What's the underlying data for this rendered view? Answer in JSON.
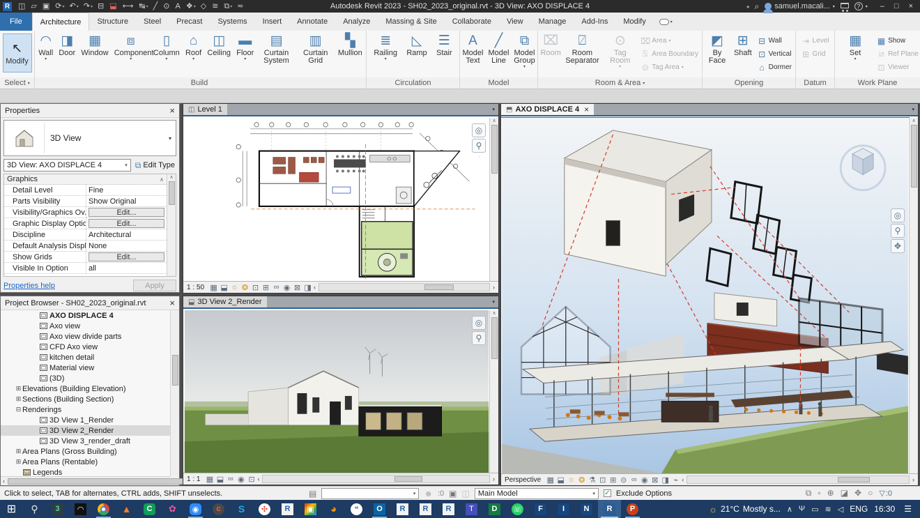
{
  "titlebar": {
    "title": "Autodesk Revit 2023 - SH02_2023_original.rvt - 3D View: AXO DISPLACE 4",
    "logo": "R",
    "quick_access": [
      {
        "name": "file-properties-icon",
        "glyph": "◫"
      },
      {
        "name": "open-file-icon",
        "glyph": "▱"
      },
      {
        "name": "save-icon",
        "glyph": "▣"
      },
      {
        "name": "sync-with-central-icon",
        "glyph": "⟳",
        "arrow": "▾"
      },
      {
        "name": "undo-icon",
        "glyph": "↶",
        "arrow": "▾"
      },
      {
        "name": "redo-icon",
        "glyph": "↷",
        "arrow": "▾"
      },
      {
        "name": "print-icon",
        "glyph": "⊟"
      },
      {
        "name": "export-pdf-icon",
        "glyph": "⬓"
      },
      {
        "name": "measure-icon",
        "glyph": "⟷"
      },
      {
        "name": "aligned-dimension-icon",
        "glyph": "↹",
        "arrow": "▾"
      },
      {
        "name": "detail-line-icon",
        "glyph": "╱"
      },
      {
        "name": "tag-by-category-icon",
        "glyph": "⊙"
      },
      {
        "name": "text-note-icon",
        "glyph": "A"
      },
      {
        "name": "default-3d-view-icon",
        "glyph": "❖",
        "arrow": "▾"
      },
      {
        "name": "section-icon",
        "glyph": "◇"
      },
      {
        "name": "thin-lines-icon",
        "glyph": "≋"
      },
      {
        "name": "switch-windows-icon",
        "glyph": "⧉",
        "arrow": "▾"
      },
      {
        "name": "customize-quick-access-icon",
        "glyph": "≂"
      }
    ],
    "collapse_arrow": "◂",
    "search_glyph": "⌕",
    "user": "samuel.macali...",
    "user_arrow": "▾",
    "help_glyph": "?",
    "help_arrow": "▾",
    "minimize": "–",
    "restore": "□",
    "close": "×"
  },
  "ribbon": {
    "tabs": [
      {
        "label": "File",
        "state": "file"
      },
      {
        "label": "Architecture",
        "state": "active"
      },
      {
        "label": "Structure"
      },
      {
        "label": "Steel"
      },
      {
        "label": "Precast"
      },
      {
        "label": "Systems"
      },
      {
        "label": "Insert"
      },
      {
        "label": "Annotate"
      },
      {
        "label": "Analyze"
      },
      {
        "label": "Massing & Site"
      },
      {
        "label": "Collaborate"
      },
      {
        "label": "View"
      },
      {
        "label": "Manage"
      },
      {
        "label": "Add-Ins"
      },
      {
        "label": "Modify"
      }
    ],
    "modify_options_arrow": "▾",
    "select": {
      "caption": "Select",
      "caption_arrow": "▾",
      "modify_label": "Modify",
      "modify_icon_glyph": "↖"
    },
    "build": {
      "caption": "Build",
      "buttons": [
        {
          "label": "Wall",
          "icon": "wall-icon",
          "glyph": "◠",
          "arrow": "▾"
        },
        {
          "label": "Door",
          "icon": "door-icon",
          "glyph": "◨"
        },
        {
          "label": "Window",
          "icon": "window-icon",
          "glyph": "▦"
        },
        {
          "label": "Component",
          "icon": "component-icon",
          "glyph": "⧈",
          "arrow": "▾"
        },
        {
          "label": "Column",
          "icon": "column-icon",
          "glyph": "▯",
          "arrow": "▾"
        },
        {
          "label": "Roof",
          "icon": "roof-icon",
          "glyph": "⌂",
          "arrow": "▾"
        },
        {
          "label": "Ceiling",
          "icon": "ceiling-icon",
          "glyph": "◫"
        },
        {
          "label": "Floor",
          "icon": "floor-icon",
          "glyph": "▬",
          "arrow": "▾"
        },
        {
          "label": "Curtain System",
          "icon": "curtain-system-icon",
          "glyph": "▤"
        },
        {
          "label": "Curtain Grid",
          "icon": "curtain-grid-icon",
          "glyph": "▥"
        },
        {
          "label": "Mullion",
          "icon": "mullion-icon",
          "glyph": "▚"
        }
      ]
    },
    "circulation": {
      "caption": "Circulation",
      "buttons": [
        {
          "label": "Railing",
          "icon": "railing-icon",
          "glyph": "≣",
          "arrow": "▾"
        },
        {
          "label": "Ramp",
          "icon": "ramp-icon",
          "glyph": "◺"
        },
        {
          "label": "Stair",
          "icon": "stair-icon",
          "glyph": "☰"
        }
      ]
    },
    "model": {
      "caption": "Model",
      "buttons": [
        {
          "label": "Model Text",
          "icon": "model-text-icon",
          "glyph": "A"
        },
        {
          "label": "Model Line",
          "icon": "model-line-icon",
          "glyph": "╱"
        },
        {
          "label": "Model Group",
          "icon": "model-group-icon",
          "glyph": "⧉",
          "arrow": "▾"
        }
      ]
    },
    "room": {
      "caption": "Room & Area",
      "caption_arrow": "▾",
      "large": [
        {
          "label": "Room",
          "icon": "room-icon",
          "glyph": "⌧",
          "state": "disabled"
        },
        {
          "label": "Room Separator",
          "icon": "room-separator-icon",
          "glyph": "⍁"
        },
        {
          "label": "Tag Room",
          "icon": "tag-room-icon",
          "glyph": "⊙",
          "arrow": "▾",
          "state": "disabled"
        }
      ],
      "small": [
        {
          "label": "Area",
          "icon": "area-icon",
          "glyph": "⌧",
          "arrow": "▾",
          "state": "disabled"
        },
        {
          "label": "Area Boundary",
          "icon": "area-boundary-icon",
          "glyph": "⍂",
          "state": "disabled"
        },
        {
          "label": "Tag Area",
          "icon": "tag-area-icon",
          "glyph": "⊙",
          "arrow": "▾",
          "state": "disabled"
        }
      ]
    },
    "opening": {
      "caption": "Opening",
      "large": [
        {
          "label": "By Face",
          "icon": "opening-by-face-icon",
          "glyph": "◩"
        },
        {
          "label": "Shaft",
          "icon": "shaft-opening-icon",
          "glyph": "⊞"
        }
      ],
      "small": [
        {
          "label": "Wall",
          "icon": "wall-opening-icon",
          "glyph": "⊟"
        },
        {
          "label": "Vertical",
          "icon": "vertical-opening-icon",
          "glyph": "⊡"
        },
        {
          "label": "Dormer",
          "icon": "dormer-opening-icon",
          "glyph": "⌂"
        }
      ]
    },
    "datum": {
      "caption": "Datum",
      "small": [
        {
          "label": "Level",
          "icon": "level-icon",
          "glyph": "⇥",
          "state": "disabled"
        },
        {
          "label": "Grid",
          "icon": "grid-icon",
          "glyph": "⊞",
          "state": "disabled"
        }
      ]
    },
    "workplane": {
      "caption": "Work Plane",
      "large": [
        {
          "label": "Set",
          "icon": "set-work-plane-icon",
          "glyph": "▦",
          "arrow": "▾"
        }
      ],
      "small": [
        {
          "label": "Show",
          "icon": "show-work-plane-icon",
          "glyph": "▦"
        },
        {
          "label": "Ref Plane",
          "icon": "ref-plane-icon",
          "glyph": "⧄",
          "state": "disabled"
        },
        {
          "label": "Viewer",
          "icon": "viewer-icon",
          "glyph": "⊡",
          "state": "disabled"
        }
      ]
    }
  },
  "properties": {
    "header": "Properties",
    "close_glyph": "×",
    "type_label": "3D View",
    "type_arrow": "▾",
    "instance": "3D View: AXO DISPLACE 4",
    "instance_arrow": "▾",
    "edit_type": "Edit Type",
    "edit_type_glyph": "⧉",
    "section": "Graphics",
    "section_glyph": "∧",
    "scroll_up": "∧",
    "scroll_down": "∨",
    "rows": [
      {
        "name": "Detail Level",
        "value": "Fine",
        "type": "text"
      },
      {
        "name": "Parts Visibility",
        "value": "Show Original",
        "type": "text"
      },
      {
        "name": "Visibility/Graphics Ov...",
        "value": "Edit...",
        "type": "button"
      },
      {
        "name": "Graphic Display Optio...",
        "value": "Edit...",
        "type": "button"
      },
      {
        "name": "Discipline",
        "value": "Architectural",
        "type": "text"
      },
      {
        "name": "Default Analysis Displ...",
        "value": "None",
        "type": "text"
      },
      {
        "name": "Show Grids",
        "value": "Edit...",
        "type": "button"
      },
      {
        "name": "Visible In Option",
        "value": "all",
        "type": "text"
      }
    ],
    "help": "Properties help",
    "apply": "Apply"
  },
  "browser": {
    "header": "Project Browser - SH02_2023_original.rvt",
    "close_glyph": "×",
    "scroll_left": "‹",
    "scroll_right": "›",
    "items": [
      {
        "label": "AXO DISPLACE 4",
        "level": "3",
        "icon": "view",
        "expander": "",
        "state": "current"
      },
      {
        "label": "Axo view",
        "level": "3",
        "icon": "view",
        "expander": ""
      },
      {
        "label": "Axo view divide parts",
        "level": "3",
        "icon": "view",
        "expander": ""
      },
      {
        "label": "CFD Axo view",
        "level": "3",
        "icon": "view",
        "expander": ""
      },
      {
        "label": "kitchen detail",
        "level": "3",
        "icon": "view",
        "expander": ""
      },
      {
        "label": "Material view",
        "level": "3",
        "icon": "view",
        "expander": ""
      },
      {
        "label": "(3D)",
        "level": "3",
        "icon": "view",
        "expander": ""
      },
      {
        "label": "Elevations (Building Elevation)",
        "level": "1",
        "icon": "none",
        "expander": "⊞"
      },
      {
        "label": "Sections (Building Section)",
        "level": "1",
        "icon": "none",
        "expander": "⊞"
      },
      {
        "label": "Renderings",
        "level": "1",
        "icon": "none",
        "expander": "⊟"
      },
      {
        "label": "3D View 1_Render",
        "level": "3",
        "icon": "view",
        "expander": ""
      },
      {
        "label": "3D View 2_Render",
        "level": "3",
        "icon": "view",
        "expander": "",
        "state": "selected"
      },
      {
        "label": "3D View 3_render_draft",
        "level": "3",
        "icon": "view",
        "expander": ""
      },
      {
        "label": "Area Plans (Gross Building)",
        "level": "1",
        "icon": "none",
        "expander": "⊞"
      },
      {
        "label": "Area Plans (Rentable)",
        "level": "1",
        "icon": "none",
        "expander": "⊞"
      },
      {
        "label": "Legends",
        "level": "1",
        "icon": "legend",
        "expander": ""
      }
    ]
  },
  "views": {
    "level1": {
      "tab": "Level 1",
      "tab_icon": "◫",
      "tab_menu": "▾",
      "scale": "1 : 50",
      "controls": [
        {
          "name": "scale-detail-icon",
          "glyph": "▦"
        },
        {
          "name": "visual-style-icon",
          "glyph": "⬓"
        },
        {
          "name": "sun-path-icon",
          "glyph": "☼"
        },
        {
          "name": "shadows-icon",
          "glyph": "❂"
        },
        {
          "name": "crop-view-icon",
          "glyph": "⊡"
        },
        {
          "name": "crop-visibility-icon",
          "glyph": "⊞"
        },
        {
          "name": "reveal-hidden-icon",
          "glyph": "∞"
        },
        {
          "name": "temporary-hide-icon",
          "glyph": "◉"
        },
        {
          "name": "analytical-model-icon",
          "glyph": "⊠"
        },
        {
          "name": "constraints-icon",
          "glyph": "◨"
        }
      ]
    },
    "render": {
      "tab": "3D View 2_Render",
      "tab_icon": "⬓",
      "tab_menu": "▾",
      "scale": "1 : 1",
      "controls": [
        {
          "name": "scale-detail-icon",
          "glyph": "▦"
        },
        {
          "name": "visual-style-icon",
          "glyph": "⬓"
        },
        {
          "name": "reveal-hidden-icon",
          "glyph": "∞"
        },
        {
          "name": "temporary-hide-icon",
          "glyph": "◉"
        },
        {
          "name": "crop-view-icon",
          "glyph": "⊡"
        }
      ]
    },
    "axo": {
      "tab": "AXO DISPLACE 4",
      "tab_icon": "⬒",
      "close_glyph": "×",
      "tab_menu": "▾",
      "scale": "Perspective",
      "controls": [
        {
          "name": "scale-detail-icon",
          "glyph": "▦"
        },
        {
          "name": "visual-style-icon",
          "glyph": "⬓"
        },
        {
          "name": "sun-path-icon",
          "glyph": "☼"
        },
        {
          "name": "shadows-icon",
          "glyph": "❂"
        },
        {
          "name": "show-rendering-dialog-icon",
          "glyph": "⚗"
        },
        {
          "name": "crop-view-icon",
          "glyph": "⊡"
        },
        {
          "name": "crop-visibility-icon",
          "glyph": "⊞"
        },
        {
          "name": "unlocked-3d-view-icon",
          "glyph": "⊝"
        },
        {
          "name": "reveal-hidden-icon",
          "glyph": "∞"
        },
        {
          "name": "temporary-hide-icon",
          "glyph": "◉"
        },
        {
          "name": "analytical-model-icon",
          "glyph": "⊠"
        },
        {
          "name": "displace-elements-icon",
          "glyph": "◨"
        },
        {
          "name": "highlight-displacement-icon",
          "glyph": "⌁"
        }
      ]
    },
    "nav": {
      "wheel_glyph": "◎",
      "zoom_glyph": "⚲",
      "pan_glyph": "✥",
      "menu_arrow": "▾"
    },
    "scroll": {
      "left": "‹",
      "right": "›",
      "up": "∧",
      "down": "∨"
    }
  },
  "statusbar": {
    "hint": "Click to select, TAB for alternates, CTRL adds, SHIFT unselects.",
    "worksets_glyph": "▤",
    "active_workset": "",
    "combo_arrow": "▾",
    "editable_glyph": "☻",
    "editable_count": ":0",
    "design_options_glyph": "▣",
    "active_only_glyph": "◫",
    "design_option": "Main Model",
    "exclude_checked": "✓",
    "exclude_label": "Exclude Options",
    "right_icons": [
      {
        "name": "select-links-icon",
        "glyph": "⧉"
      },
      {
        "name": "select-underlay-icon",
        "glyph": "▫"
      },
      {
        "name": "select-pinned-icon",
        "glyph": "⊕"
      },
      {
        "name": "select-by-face-icon",
        "glyph": "◪"
      },
      {
        "name": "drag-on-selection-icon",
        "glyph": "✥"
      },
      {
        "name": "background-processes-icon",
        "glyph": "○"
      }
    ],
    "filter_glyph": "▽",
    "filter_count": ":0"
  },
  "taskbar": {
    "apps": [
      {
        "name": "start-button",
        "glyph": "⊞",
        "style": "color:#fff;font-size:16px"
      },
      {
        "name": "search-icon",
        "glyph": "⚲",
        "style": "color:#e8e8e8;font-size:14px"
      },
      {
        "name": "3ds-max-icon",
        "glyph": "3",
        "style": "background:#2b3f46;color:#5fd0a5;font-weight:bold"
      },
      {
        "name": "screen-recorder-icon",
        "glyph": "◠",
        "style": "background:#111;color:#eee"
      },
      {
        "name": "chrome-icon",
        "glyph": "",
        "style": "",
        "state": "running"
      },
      {
        "name": "vlc-icon",
        "glyph": "▲",
        "style": "color:#ff7c1e;font-size:14px"
      },
      {
        "name": "camtasia-icon",
        "glyph": "C",
        "style": "background:#0f9d58;color:#fff;border-radius:4px;font-weight:bold"
      },
      {
        "name": "paint-app-icon",
        "glyph": "✿",
        "style": "color:#e4589f;font-size:13px"
      },
      {
        "name": "zoom-icon",
        "glyph": "◉",
        "style": "background:#2d8cff;color:#fff;border-radius:5px",
        "state": "running"
      },
      {
        "name": "ccleaner-icon",
        "glyph": "c",
        "style": "background:#494949;color:#ff5a3c;border-radius:50%;font-weight:bold"
      },
      {
        "name": "skype-icon",
        "glyph": "S",
        "style": "color:#29a8e0;font-weight:bold;font-size:14px"
      },
      {
        "name": "photos-pinwheel-icon",
        "glyph": "✣",
        "style": "background:#fff;color:#ea4335;border-radius:50%"
      },
      {
        "name": "revit-icon",
        "glyph": "R",
        "style": "background:#f2f2f2;color:#2a63a8;font-weight:bold"
      },
      {
        "name": "photos-icon",
        "glyph": "▣",
        "style": "background:linear-gradient(135deg,#d93025,#fbbc04 40%,#34a853 70%,#4285f4);color:#fff"
      },
      {
        "name": "firefox-icon",
        "glyph": "◕",
        "style": "color:#ff9400;font-size:15px"
      },
      {
        "name": "chat-app-icon",
        "glyph": "❝",
        "style": "background:#fff;color:#777;border-radius:50%"
      },
      {
        "name": "outlook-icon",
        "glyph": "O",
        "style": "background:#0a64a4;color:#fff;font-weight:bold",
        "state": "running"
      },
      {
        "name": "revit-2-icon",
        "glyph": "R",
        "style": "background:#f2f2f2;color:#2a63a8;font-weight:bold"
      },
      {
        "name": "revit-3-icon",
        "glyph": "R",
        "style": "background:#f2f2f2;color:#2a63a8;font-weight:bold"
      },
      {
        "name": "revit-4-icon",
        "glyph": "R",
        "style": "background:#f2f2f2;color:#2a63a8;font-weight:bold"
      },
      {
        "name": "teams-icon",
        "glyph": "T",
        "style": "background:#464eb8;color:#fff"
      },
      {
        "name": "d-app-icon",
        "glyph": "D",
        "style": "background:#127c42;color:#fff;font-weight:bold"
      },
      {
        "name": "whatsapp-icon",
        "glyph": "☏",
        "style": "background:#25d366;color:#fff;border-radius:50%"
      },
      {
        "name": "f-app-icon",
        "glyph": "F",
        "style": "background:#17457c;color:#fff;font-weight:bold"
      },
      {
        "name": "i-app-icon",
        "glyph": "I",
        "style": "background:#17457c;color:#fff;font-weight:bold"
      },
      {
        "name": "n-app-icon",
        "glyph": "N",
        "style": "background:#17457c;color:#fff;font-weight:bold"
      },
      {
        "name": "revit-active-icon",
        "glyph": "R",
        "style": "background:#2d5c94;color:#fff;font-weight:bold",
        "state": "highlighted"
      },
      {
        "name": "powerpoint-icon",
        "glyph": "P",
        "style": "background:#c8401a;color:#fff;border-radius:50%;font-weight:bold",
        "state": "running"
      }
    ],
    "weather_glyph": "☼",
    "weather_temp": "21°C",
    "weather_desc": "Mostly s...",
    "tray": [
      {
        "name": "hidden-icons-chevron",
        "glyph": "∧"
      },
      {
        "name": "microphone-icon",
        "glyph": "Ψ"
      },
      {
        "name": "touchpad-icon",
        "glyph": "▭"
      },
      {
        "name": "wifi-icon",
        "glyph": "≋"
      },
      {
        "name": "volume-icon",
        "glyph": "◁"
      }
    ],
    "language": "ENG",
    "time": "16:30",
    "notifications_glyph": "☰"
  }
}
